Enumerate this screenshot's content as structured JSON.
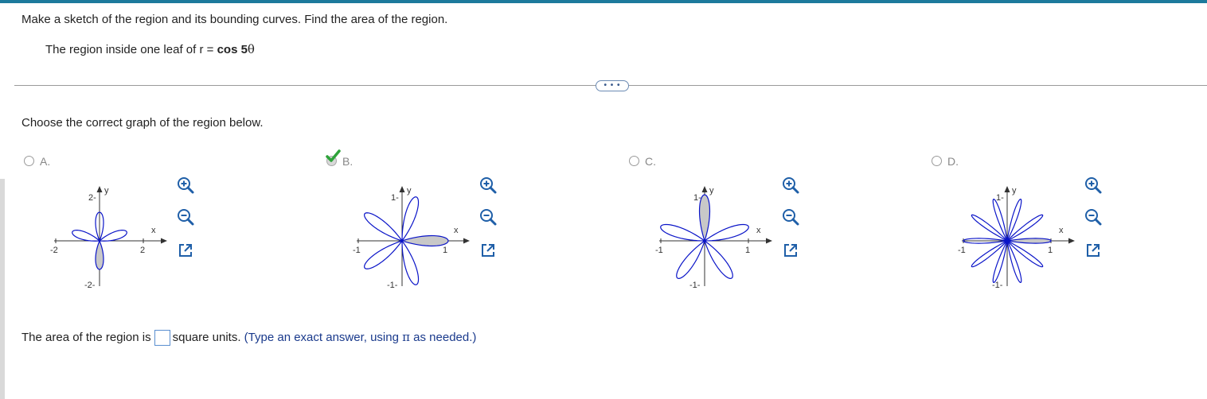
{
  "problem": {
    "prompt": "Make a sketch of the region and its bounding curves. Find the area of the region.",
    "sub_prefix": "The region inside one leaf of r = ",
    "sub_fn": "cos 5",
    "sub_var": "θ"
  },
  "more_button": "• • •",
  "instruction": "Choose the correct graph of the region below.",
  "options": [
    {
      "letter": "A.",
      "selected": false,
      "petals": 4,
      "x_max": 2,
      "y_max": 2,
      "x_tick_pos": "2",
      "x_tick_neg": "-2",
      "y_tick_pos": "2-",
      "y_tick_neg": "-2-",
      "shaded_petal": "bottom",
      "x_label": "x",
      "y_label": "y"
    },
    {
      "letter": "B.",
      "selected": true,
      "petals": 5,
      "x_max": 1,
      "y_max": 1,
      "x_tick_pos": "1",
      "x_tick_neg": "-1",
      "y_tick_pos": "1-",
      "y_tick_neg": "-1-",
      "shaded_petal": "right",
      "x_label": "x",
      "y_label": "y"
    },
    {
      "letter": "C.",
      "selected": false,
      "petals": 5,
      "x_max": 1,
      "y_max": 1,
      "x_tick_pos": "1",
      "x_tick_neg": "-1",
      "y_tick_pos": "1-",
      "y_tick_neg": "-1-",
      "shaded_petal": "top",
      "x_label": "x",
      "y_label": "y"
    },
    {
      "letter": "D.",
      "selected": false,
      "petals": 10,
      "x_max": 1,
      "y_max": 1,
      "x_tick_pos": "1",
      "x_tick_neg": "-1",
      "y_tick_pos": "1-",
      "y_tick_neg": "-1-",
      "shaded_petal": "right",
      "x_label": "x",
      "y_label": "y"
    }
  ],
  "answer": {
    "prefix": "The area of the region is",
    "value": "",
    "suffix": "square units.",
    "hint_prefix": "(Type an exact answer, using ",
    "hint_pi": "π",
    "hint_suffix": " as needed.)"
  },
  "colors": {
    "accent_bar": "#1c7a9c",
    "curve": "#0a14c8",
    "shade": "#c8c8c8",
    "check": "#2ea33a",
    "tool_blue": "#1f5fa8"
  },
  "icons": [
    "zoom-in-icon",
    "zoom-out-icon",
    "popout-icon",
    "check-icon"
  ]
}
